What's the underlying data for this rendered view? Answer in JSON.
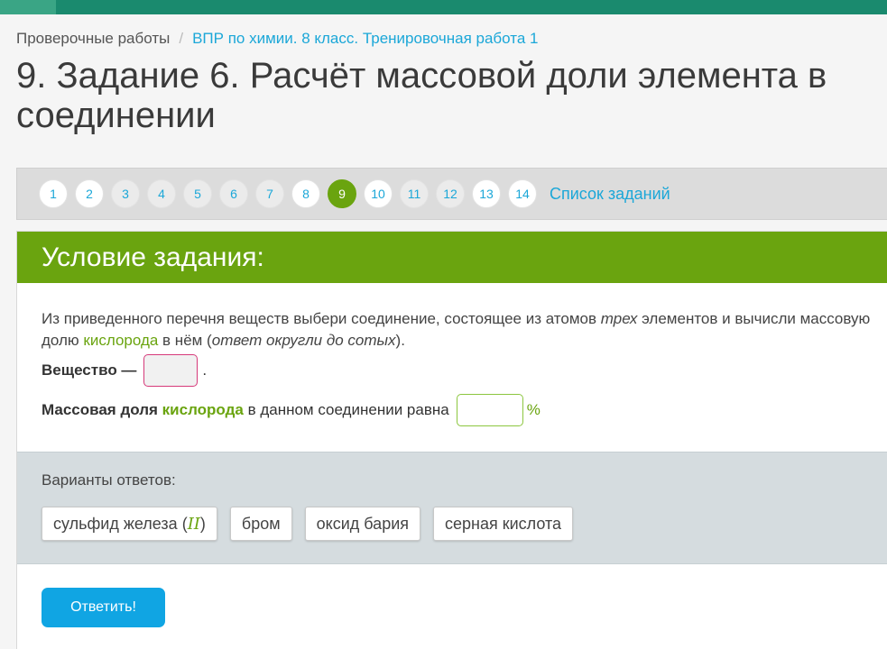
{
  "breadcrumb": {
    "parent": "Проверочные работы",
    "separator": "/",
    "current": "ВПР по химии. 8 класс. Тренировочная работа 1"
  },
  "page_title": "9. Задание 6. Расчёт массовой доли элемента в соединении",
  "pager": {
    "pages": [
      "1",
      "2",
      "3",
      "4",
      "5",
      "6",
      "7",
      "8",
      "9",
      "10",
      "11",
      "12",
      "13",
      "14"
    ],
    "active_page": "9",
    "task_list_label": "Список заданий"
  },
  "task": {
    "header": "Условие задания:",
    "condition": {
      "p1": "Из приведенного перечня веществ выбери соединение, состоящее из атомов ",
      "em1": "трех",
      "p2": " элементов и вычисли массовую долю ",
      "highlight": "кислорода",
      "p3": " в нём (",
      "em2": "ответ округли до сотых",
      "p4": ")."
    },
    "substance_row": {
      "label": "Вещество —",
      "end": "."
    },
    "mass_row": {
      "label_prefix": "Массовая доля",
      "label_highlight": "кислорода",
      "label_suffix": "в данном соединении равна",
      "input_value": "",
      "unit": "%"
    },
    "answers": {
      "label": "Варианты ответов:",
      "options": [
        {
          "text": "сульфид железа (",
          "roman": "II",
          "close": ")"
        },
        {
          "text": "бром"
        },
        {
          "text": "оксид бария"
        },
        {
          "text": "серная кислота"
        }
      ]
    },
    "submit_label": "Ответить!"
  },
  "colors": {
    "accent_green": "#6aa40f",
    "link_blue": "#1ba7d8",
    "button_blue": "#10a5e3",
    "top_bar": "#1a8a6e"
  }
}
